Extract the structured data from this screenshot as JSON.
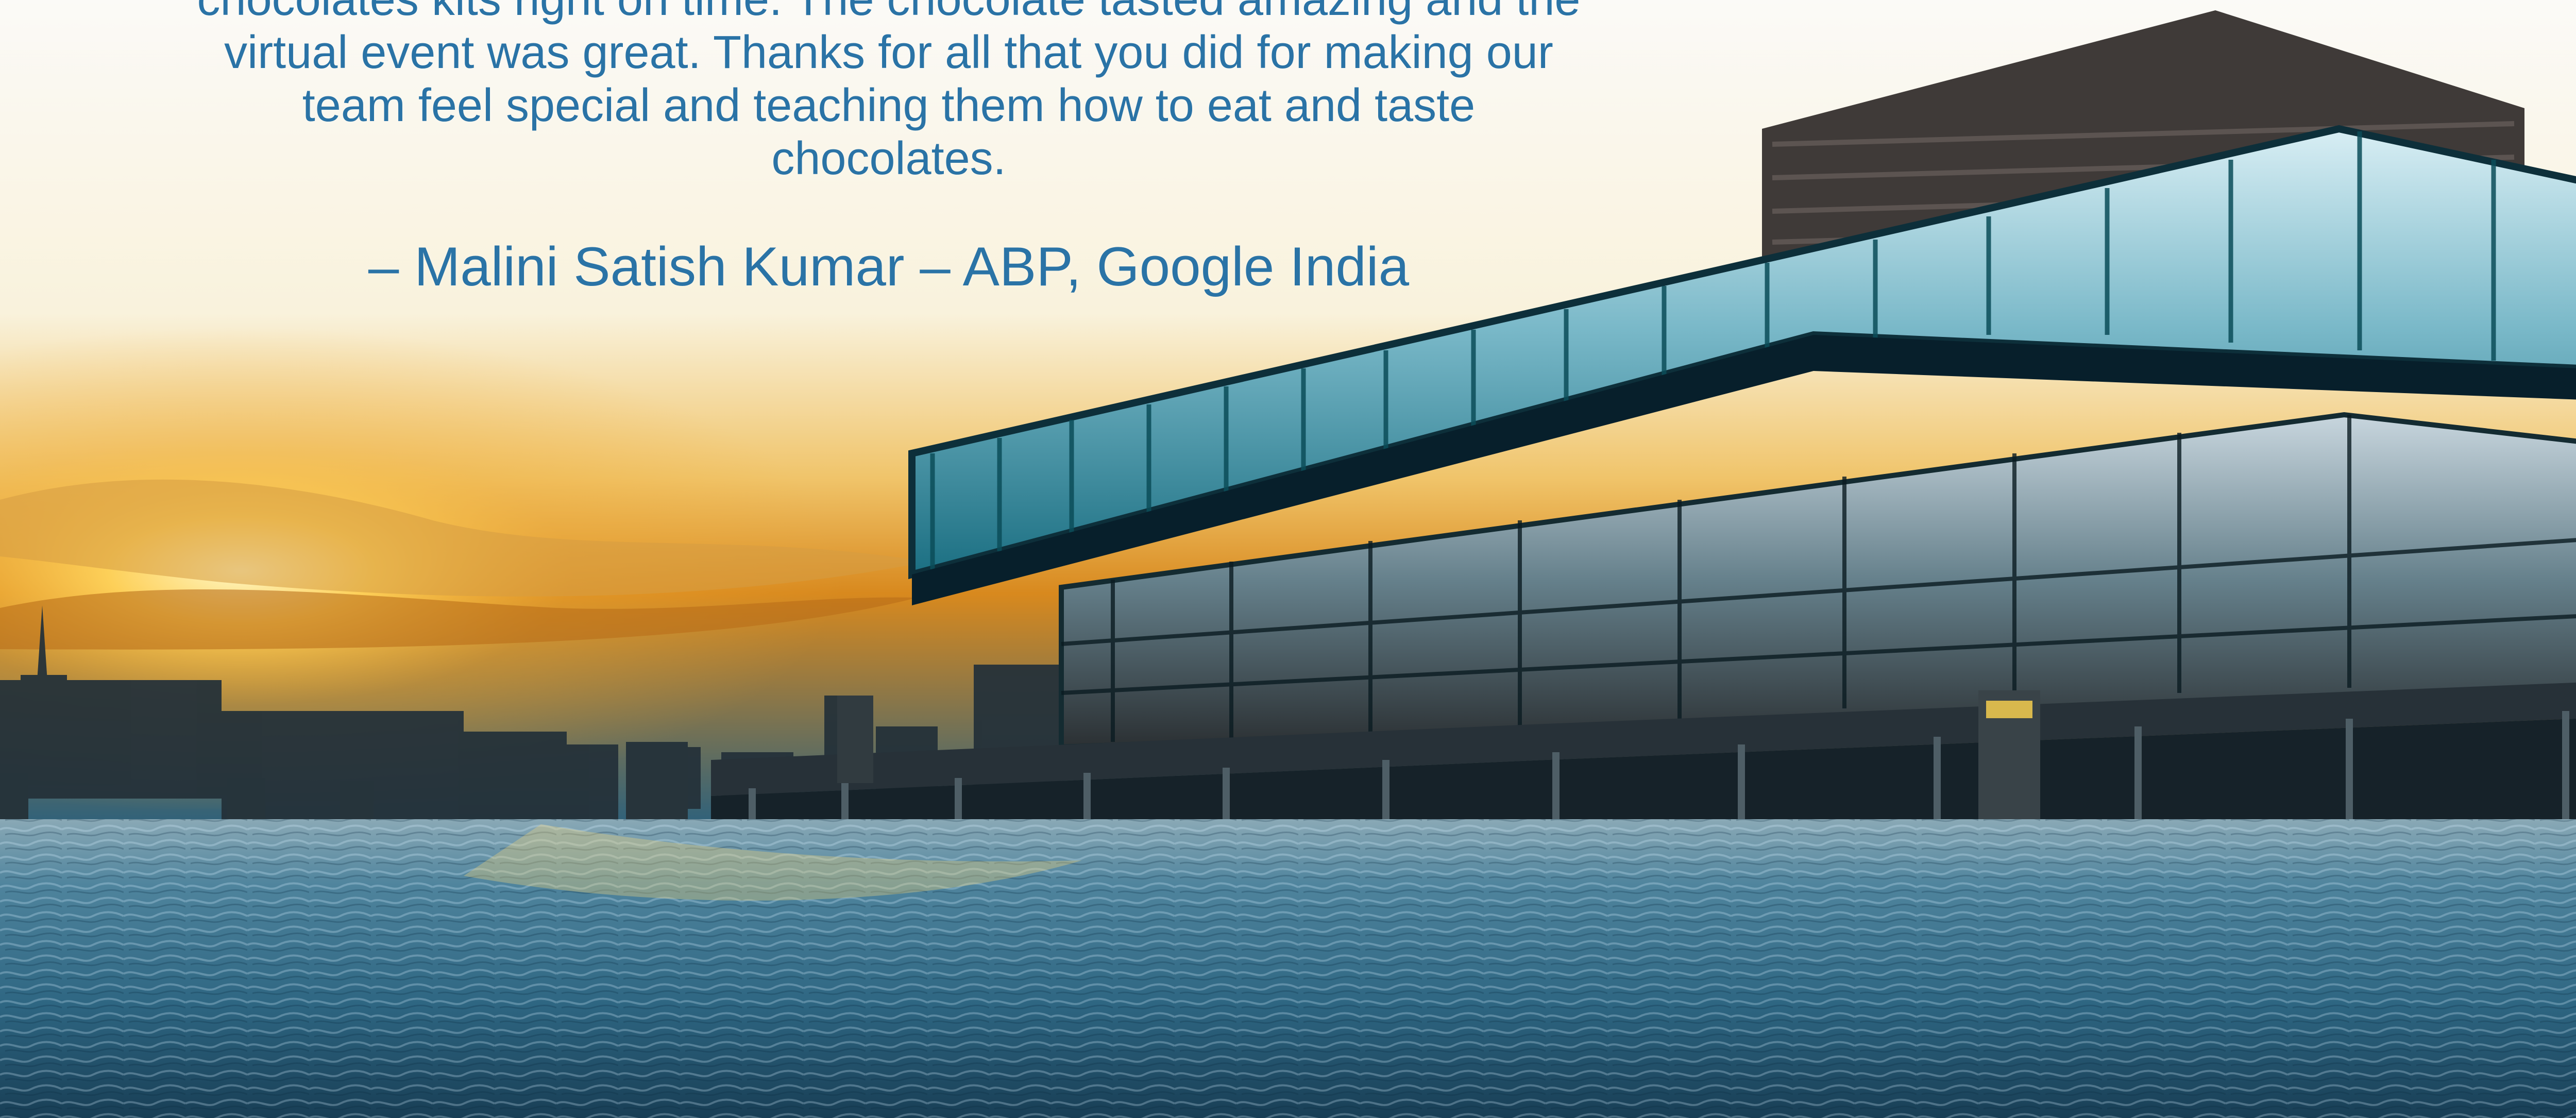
{
  "testimonial": {
    "quote_lines": [
      "chocolates kits right on time. The chocolate tasted amazing and the",
      "virtual event was great. Thanks for all that you did for making our",
      "team feel special and teaching them how to eat and taste",
      "chocolates."
    ],
    "attribution": "– Malini Satish Kumar – ABP, Google India"
  },
  "colors": {
    "quote_text": "#2a73a6",
    "water": "#4b8fb3",
    "sky": "#f9f6ee"
  }
}
